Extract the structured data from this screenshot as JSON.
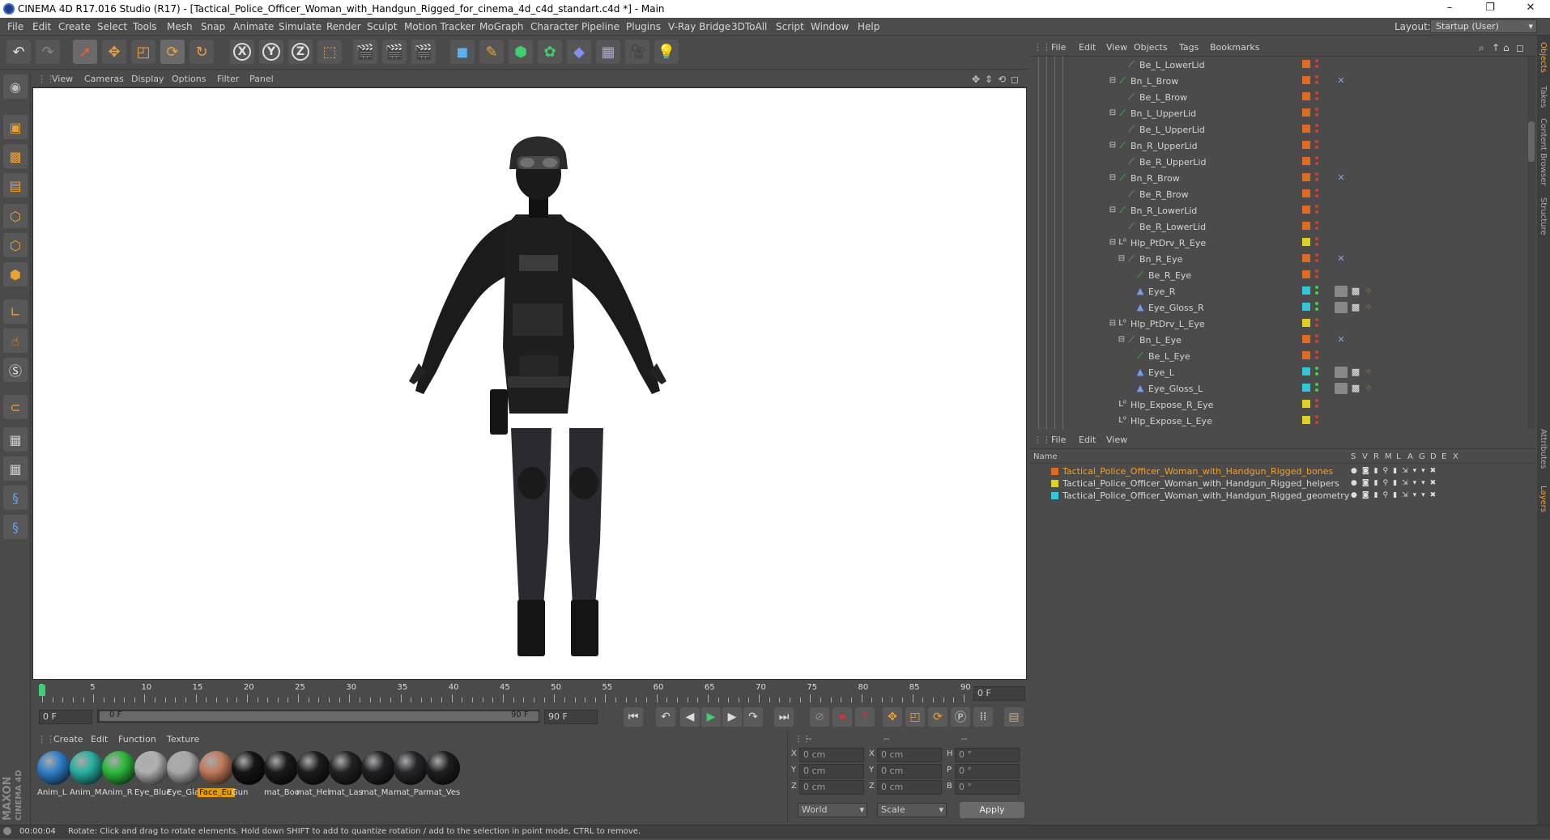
{
  "window": {
    "title": "CINEMA 4D R17.016 Studio (R17) - [Tactical_Police_Officer_Woman_with_Handgun_Rigged_for_cinema_4d_c4d_standart.c4d *] - Main",
    "minimize": "–",
    "restore": "❐",
    "close": "✕"
  },
  "menubar": {
    "items": [
      "File",
      "Edit",
      "Create",
      "Select",
      "Tools",
      "Mesh",
      "Snap",
      "Animate",
      "Simulate",
      "Render",
      "Sculpt",
      "Motion Tracker",
      "MoGraph",
      "Character",
      "Pipeline",
      "Plugins",
      "V-Ray Bridge",
      "3DToAll",
      "Script",
      "Window",
      "Help"
    ],
    "layout_label": "Layout:",
    "layout_value": "Startup (User)"
  },
  "toolbar": {
    "x_label": "X",
    "y_label": "Y",
    "z_label": "Z"
  },
  "viewport": {
    "menu": [
      "View",
      "Cameras",
      "Display",
      "Options",
      "Filter",
      "Panel"
    ]
  },
  "timeline": {
    "ticks": [
      "0",
      "5",
      "10",
      "15",
      "20",
      "25",
      "30",
      "35",
      "40",
      "45",
      "50",
      "55",
      "60",
      "65",
      "70",
      "75",
      "80",
      "85",
      "90"
    ],
    "current_frame": "0 F",
    "start_field": "0 F",
    "range_start": "0 F",
    "range_end": "90 F",
    "end_field": "90 F"
  },
  "materials": {
    "menu": [
      "Create",
      "Edit",
      "Function",
      "Texture"
    ],
    "items": [
      {
        "label": "Anim_L",
        "color": "#2f7fc8"
      },
      {
        "label": "Anim_M",
        "color": "#27b0a0"
      },
      {
        "label": "Anim_R",
        "color": "#2cb83a"
      },
      {
        "label": "Eye_Blue",
        "color": "#b0b0b0"
      },
      {
        "label": "Eye_Glas",
        "color": "#a8a8a8"
      },
      {
        "label": "Face_Eu",
        "color": "#c07a5a"
      },
      {
        "label": "Gun",
        "color": "#151515"
      },
      {
        "label": "mat_Boo",
        "color": "#1a1a1a"
      },
      {
        "label": "mat_Hel",
        "color": "#1c1c1c"
      },
      {
        "label": "mat_Las",
        "color": "#222222"
      },
      {
        "label": "mat_Ma",
        "color": "#202024"
      },
      {
        "label": "mat_Par",
        "color": "#26262a"
      },
      {
        "label": "mat_Ves",
        "color": "#1e1e1e"
      }
    ]
  },
  "coords": {
    "header": [
      "--",
      "--",
      "--"
    ],
    "rows": [
      {
        "a": "X",
        "av": "0 cm",
        "b": "X",
        "bv": "0 cm",
        "c": "H",
        "cv": "0 °"
      },
      {
        "a": "Y",
        "av": "0 cm",
        "b": "Y",
        "bv": "0 cm",
        "c": "P",
        "cv": "0 °"
      },
      {
        "a": "Z",
        "av": "0 cm",
        "b": "Z",
        "bv": "0 cm",
        "c": "B",
        "cv": "0 °"
      }
    ],
    "space": "World",
    "mode": "Scale",
    "apply": "Apply"
  },
  "objects": {
    "menu": [
      "File",
      "Edit",
      "View",
      "Objects",
      "Tags",
      "Bookmarks"
    ],
    "rows": [
      {
        "name": "Be_L_LowerLid",
        "indent": 3,
        "type": "bone",
        "tag": "#e06a20",
        "dot": "#d04030"
      },
      {
        "name": "Bn_L_Brow",
        "indent": 2,
        "type": "bone",
        "tag": "#e06a20",
        "dot": "#d04030",
        "expand": true,
        "extra": "ik"
      },
      {
        "name": "Be_L_Brow",
        "indent": 3,
        "type": "bone",
        "tag": "#e06a20",
        "dot": "#d04030"
      },
      {
        "name": "Bn_L_UpperLid",
        "indent": 2,
        "type": "bone",
        "tag": "#e06a20",
        "dot": "#d04030",
        "expand": true
      },
      {
        "name": "Be_L_UpperLid",
        "indent": 3,
        "type": "bone",
        "tag": "#e06a20",
        "dot": "#d04030"
      },
      {
        "name": "Bn_R_UpperLid",
        "indent": 2,
        "type": "bone",
        "tag": "#e06a20",
        "dot": "#d04030",
        "expand": true
      },
      {
        "name": "Be_R_UpperLid",
        "indent": 3,
        "type": "bone",
        "tag": "#e06a20",
        "dot": "#d04030"
      },
      {
        "name": "Bn_R_Brow",
        "indent": 2,
        "type": "bone",
        "tag": "#e06a20",
        "dot": "#d04030",
        "expand": true,
        "extra": "ik"
      },
      {
        "name": "Be_R_Brow",
        "indent": 3,
        "type": "bone",
        "tag": "#e06a20",
        "dot": "#d04030"
      },
      {
        "name": "Bn_R_LowerLid",
        "indent": 2,
        "type": "bone",
        "tag": "#e06a20",
        "dot": "#d04030",
        "expand": true
      },
      {
        "name": "Be_R_LowerLid",
        "indent": 3,
        "type": "bone",
        "tag": "#e06a20",
        "dot": "#d04030"
      },
      {
        "name": "Hlp_PtDrv_R_Eye",
        "indent": 2,
        "type": "null",
        "tag": "#e0d020",
        "dot": "#d04030",
        "expand": true
      },
      {
        "name": "Bn_R_Eye",
        "indent": 3,
        "type": "bone",
        "tag": "#e06a20",
        "dot": "#d04030",
        "expand": true,
        "extra": "ik"
      },
      {
        "name": "Be_R_Eye",
        "indent": 4,
        "type": "bone",
        "tag": "#e06a20",
        "dot": "#d04030"
      },
      {
        "name": "Eye_R",
        "indent": 4,
        "type": "mesh",
        "tag": "#30c8d8",
        "dot": "#40d040",
        "extra": "mat"
      },
      {
        "name": "Eye_Gloss_R",
        "indent": 4,
        "type": "mesh",
        "tag": "#30c8d8",
        "dot": "#40d040",
        "extra": "mat"
      },
      {
        "name": "Hlp_PtDrv_L_Eye",
        "indent": 2,
        "type": "null",
        "tag": "#e0d020",
        "dot": "#d04030",
        "expand": true
      },
      {
        "name": "Bn_L_Eye",
        "indent": 3,
        "type": "bone",
        "tag": "#e06a20",
        "dot": "#d04030",
        "expand": true,
        "extra": "ik"
      },
      {
        "name": "Be_L_Eye",
        "indent": 4,
        "type": "bone",
        "tag": "#e06a20",
        "dot": "#d04030"
      },
      {
        "name": "Eye_L",
        "indent": 4,
        "type": "mesh",
        "tag": "#30c8d8",
        "dot": "#40d040",
        "extra": "mat"
      },
      {
        "name": "Eye_Gloss_L",
        "indent": 4,
        "type": "mesh",
        "tag": "#30c8d8",
        "dot": "#40d040",
        "extra": "mat"
      },
      {
        "name": "Hlp_Expose_R_Eye",
        "indent": 2,
        "type": "null",
        "tag": "#e0d020",
        "dot": "#d04030"
      },
      {
        "name": "Hlp_Expose_L_Eye",
        "indent": 2,
        "type": "null",
        "tag": "#e0d020",
        "dot": "#d04030"
      }
    ]
  },
  "layers": {
    "menu": [
      "File",
      "Edit",
      "View"
    ],
    "header": {
      "name": "Name",
      "cols": [
        "S",
        "V",
        "R",
        "M",
        "L",
        "A",
        "G",
        "D",
        "E",
        "X"
      ]
    },
    "rows": [
      {
        "name": "Tactical_Police_Officer_Woman_with_Handgun_Rigged_bones",
        "color": "#e06a20",
        "text_color": "#f0a030"
      },
      {
        "name": "Tactical_Police_Officer_Woman_with_Handgun_Rigged_helpers",
        "color": "#e0d020",
        "text_color": "#d8d8d8"
      },
      {
        "name": "Tactical_Police_Officer_Woman_with_Handgun_Rigged_geometry",
        "color": "#30c8d8",
        "text_color": "#d8d8d8"
      }
    ]
  },
  "side_tabs": [
    "Objects",
    "Takes",
    "Content Browser",
    "Structure",
    "Attributes",
    "Layers"
  ],
  "status": {
    "time": "00:00:04",
    "message": "Rotate: Click and drag to rotate elements. Hold down SHIFT to add to quantize rotation / add to the selection in point mode, CTRL to remove."
  },
  "logo": {
    "line1": "MAXON",
    "line2": "CINEMA 4D"
  },
  "colors": {
    "accent": "#f0a030",
    "keyframe": "#3cd070"
  }
}
